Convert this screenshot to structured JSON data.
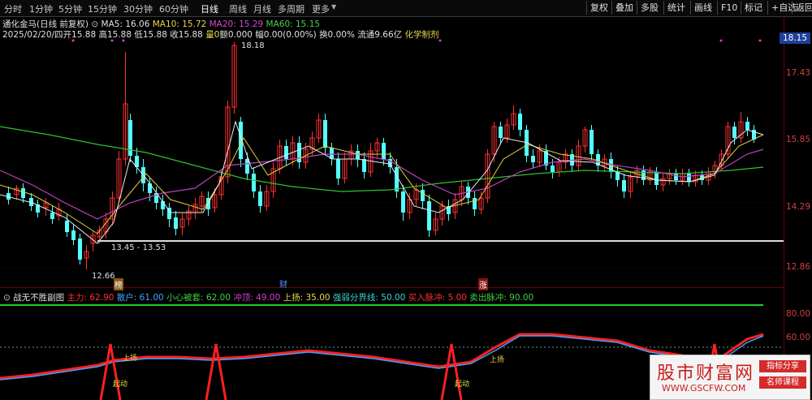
{
  "toolbar": {
    "periods": [
      "分时",
      "1分钟",
      "5分钟",
      "15分钟",
      "30分钟",
      "60分钟",
      "日线",
      "周线",
      "月线",
      "多周期",
      "更多"
    ],
    "active_period": "日线",
    "actions": [
      "复权",
      "叠加",
      "多股",
      "统计",
      "画线",
      "F10",
      "标记",
      "+自选",
      "返回"
    ]
  },
  "info": {
    "stock": "通化金马(日线 前复权)",
    "ma5": "MA5: 16.06",
    "ma10": "MA10: 15.72",
    "ma20": "MA20: 15.29",
    "ma60": "MA60: 15.15",
    "date": "2025/02/20/四",
    "open": "开15.88",
    "high": "高15.88",
    "low": "低15.88",
    "close": "收15.88",
    "vol": "量0",
    "amount": "额0.000",
    "change": "幅0.00(0.00%)",
    "turnover": "换0.00%",
    "float": "流通9.66亿",
    "sector": "化学制剂"
  },
  "price_axis": [
    "18.15",
    "17.43",
    "15.85",
    "14.29",
    "12.86"
  ],
  "current_price": "18.15",
  "annotations": {
    "high": "18.18",
    "low": "12.66",
    "range": "13.45 - 13.53",
    "marker1": "榜",
    "marker2": "财",
    "marker3": "涨"
  },
  "indicator": {
    "name": "战无不胜副图",
    "zhuli": "主力: 62.90",
    "sanhu": "散户: 61.00",
    "xiaoxin": "小心被套: 62.00",
    "chongding": "冲顶: 49.00",
    "shangyang": "上扬: 35.00",
    "qiangruo": "强弱分界线: 50.00",
    "mairu": "买入脉冲: 5.00",
    "maichu": "卖出脉冲: 90.00",
    "axis": [
      "80.00",
      "60.00"
    ],
    "label_up": "上扬",
    "label_qi": "起动"
  },
  "watermark": {
    "title": "股市财富网",
    "url": "WWW.GSCFW.COM",
    "tag1": "指标分享",
    "tag2": "名师课程"
  }
}
